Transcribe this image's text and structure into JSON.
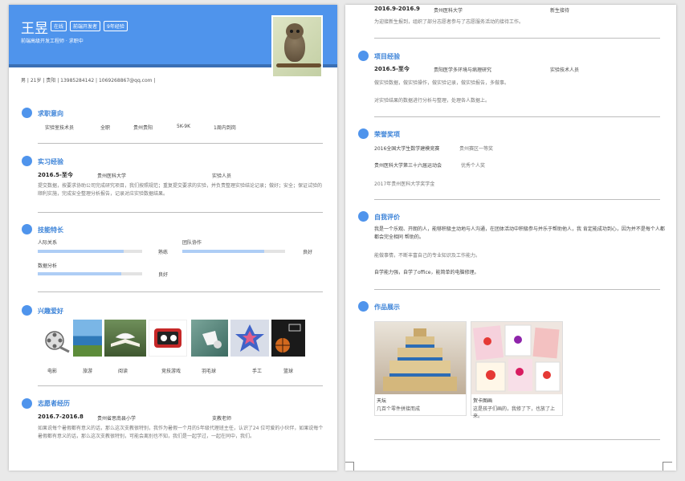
{
  "header": {
    "name": "王昱",
    "tags": [
      "在线",
      "前端开发者",
      "9年经验"
    ],
    "summary": "前端高级开发工程师 · 求职中",
    "contact": "男 | 21岁 | 贵阳 | 13985284142 | 1069268867@qq.com |"
  },
  "intention": {
    "title": "求职意向",
    "items": [
      "实验室技术员",
      "全职",
      "贵州贵阳",
      "5K-9K",
      "1周内到岗"
    ]
  },
  "internship": {
    "title": "实习经验",
    "period": "2016.5-至今",
    "org": "贵州医科大学",
    "role": "实验人员",
    "desc": "提交数据，按要求协助公司完成研究项目，我们按照规范；重复提交要求的实验，并负责整理实验结论记录；做好；安全；保证试验的顺利实施，完成安全整理分析报告，记录对应实验数据结果。"
  },
  "skills": {
    "title": "技能特长",
    "items": [
      {
        "name": "人际关系",
        "level": "熟练",
        "pct": 0.82
      },
      {
        "name": "团队协作",
        "level": "良好",
        "pct": 0.8
      },
      {
        "name": "数据分析",
        "level": "良好",
        "pct": 0.8
      }
    ]
  },
  "hobbies": {
    "title": "兴趣爱好",
    "labels": [
      "电影",
      "旅游",
      "阅读",
      "竞技游戏",
      "羽毛球",
      "手工",
      "篮球"
    ]
  },
  "volunteer": {
    "title": "志愿者经历",
    "period": "2016.7-2016.8",
    "org": "贵州省思南县小学",
    "role": "支教老师",
    "desc": "如果说每个暑假都有意义的话，那么这次支教很特别，我作为暑假一个月的5年级代理班主任，认识了24 位可爱的小伙伴，如果说每个暑假都有意义的话，那么这次支教很特别，可能会离别也不知，我们是一起学过，一起在同中，我们。",
    "cont_period": "2016.9-2016.9",
    "cont_org": "贵州医科大学",
    "cont_role": "新生接待",
    "cont_desc": "为迎接新生报到，组织了部分志愿者参与了志愿服务活动的接待工作。"
  },
  "project": {
    "title": "项目经验",
    "period": "2016.5-至今",
    "name": "贵阳医学多环境与病理研究",
    "role": "实验技术人员",
    "desc1": "做实验数据，做实验操作，做实验记录，做实验报告，多做事。",
    "desc2": "对实验结果的数据进行分析与整理，处理各人数据上。"
  },
  "awards": {
    "title": "荣誉奖项",
    "items": [
      {
        "name": "2016全国大学生数学建模竞赛",
        "note": "贵州赛区一等奖"
      },
      {
        "name": "贵州医科大学第三十六届运动会",
        "note": "优秀个人奖"
      },
      {
        "name": "2017年贵州医科大学奖学金",
        "note": ""
      }
    ]
  },
  "evaluation": {
    "title": "自我评价",
    "p1": "我是一个乐观、开朗的人，能够积极主动地与人沟通，在团体活动中积极参与并乐于帮助他人，我 肯定能成功到心，因为并不是每个人都都会完全相同 帮助的。",
    "p2": "能做事情，不断丰富自己的专业知识及工作能力。",
    "p3": "自学能力强，自学了office，能简单的电脑修理。"
  },
  "works": {
    "title": "作品展示",
    "items": [
      {
        "cap1": "天坛",
        "cap2": "几百个零件拼接而成"
      },
      {
        "cap1": "贺卡图画",
        "cap2": "这是孩子们画的，我修了下，也放了上来。"
      }
    ]
  }
}
